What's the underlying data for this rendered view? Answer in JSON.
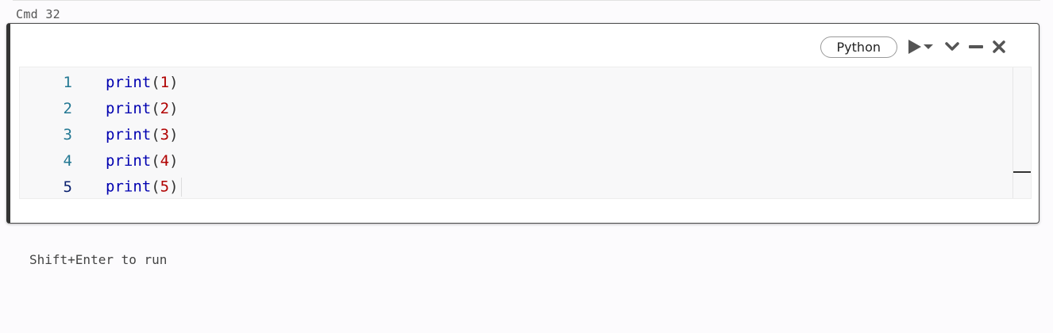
{
  "cell": {
    "cmd_label": "Cmd 32",
    "language": "Python",
    "icons": {
      "run": "run-dropdown-icon",
      "collapse": "chevron-down-icon",
      "minimize": "minimize-icon",
      "close": "close-icon"
    }
  },
  "editor": {
    "lines": [
      {
        "num": "1",
        "fn": "print",
        "open": "(",
        "arg": "1",
        "close": ")"
      },
      {
        "num": "2",
        "fn": "print",
        "open": "(",
        "arg": "2",
        "close": ")"
      },
      {
        "num": "3",
        "fn": "print",
        "open": "(",
        "arg": "3",
        "close": ")"
      },
      {
        "num": "4",
        "fn": "print",
        "open": "(",
        "arg": "4",
        "close": ")"
      },
      {
        "num": "5",
        "fn": "print",
        "open": "(",
        "arg": "5",
        "close": ")"
      }
    ],
    "active_line": 5
  },
  "hint": "Shift+Enter to run",
  "colors": {
    "function": "#0000b0",
    "number": "#b00000",
    "line_number": "#237893",
    "active_line_number": "#0b216f"
  }
}
